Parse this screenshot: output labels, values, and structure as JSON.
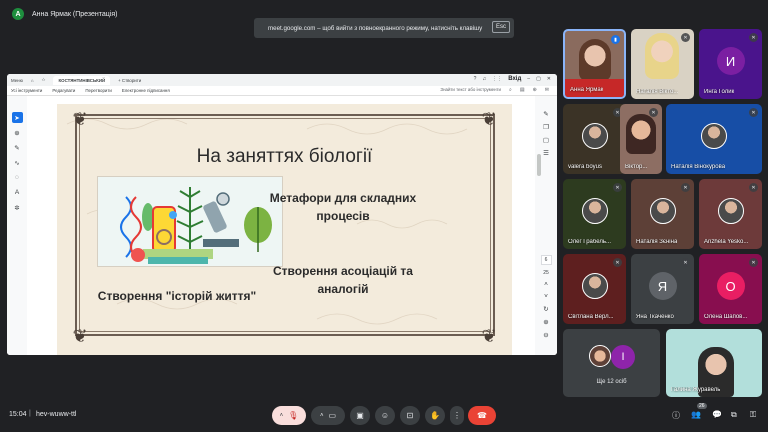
{
  "topbar": {
    "presenter_initial": "A",
    "presenter_label": "Анна Ярмак (Презентація)",
    "fullscreen_hint": "meet.google.com – щоб вийти з повноекранного режиму, натисніть клавішу",
    "esc_key": "Esc"
  },
  "presentation": {
    "tabs": [
      "Меню",
      "КОСТЯНТИНІВСЬКИЙ",
      "Створити"
    ],
    "login": "Вхід",
    "menu": [
      "Усі інструменти",
      "Редагувати",
      "Перетворити",
      "Електронне підписання"
    ],
    "search_placeholder": "Знайти текст або інструменти",
    "page_number": "6",
    "page_total": "25"
  },
  "slide": {
    "title": "На заняттях біології",
    "item1": "Метафори для складних процесів",
    "item2": "Створення асоціацій та аналогій",
    "item3": "Створення \"історій життя\""
  },
  "participants": [
    {
      "name": "Анна Ярмак",
      "type": "video",
      "speaking": true
    },
    {
      "name": "Наталія Вікто...",
      "type": "video",
      "speaking": false
    },
    {
      "name": "Инга Голик",
      "type": "letter",
      "letter": "И",
      "color": "#7b1fa2"
    },
    {
      "name": "valera boyus",
      "type": "photo"
    },
    {
      "name": "Віктор...",
      "type": "photo"
    },
    {
      "name": "Наталія Вінокурова",
      "type": "photo"
    },
    {
      "name": "Олег Грабель...",
      "type": "photo"
    },
    {
      "name": "Наталія Зєніна",
      "type": "photo"
    },
    {
      "name": "Anzhela Yesko...",
      "type": "photo"
    },
    {
      "name": "Світлана Верл...",
      "type": "photo"
    },
    {
      "name": "Яна Ткаченко",
      "type": "letter",
      "letter": "Я",
      "color": "#3c4043"
    },
    {
      "name": "Олена Шапов...",
      "type": "letter",
      "letter": "О",
      "color": "#e91e63"
    },
    {
      "name": "Ще 12 осіб",
      "type": "more",
      "letter": "I",
      "color": "#8e24aa"
    },
    {
      "name": "Галина Журавель",
      "type": "video",
      "speaking": false
    }
  ],
  "bottombar": {
    "time": "15:04",
    "separator": "|",
    "meeting_code": "hev-wuww-ttl",
    "participants_count": "26"
  },
  "colors": {
    "background": "#202124",
    "hangup": "#ea4335",
    "accent": "#1a73e8"
  }
}
